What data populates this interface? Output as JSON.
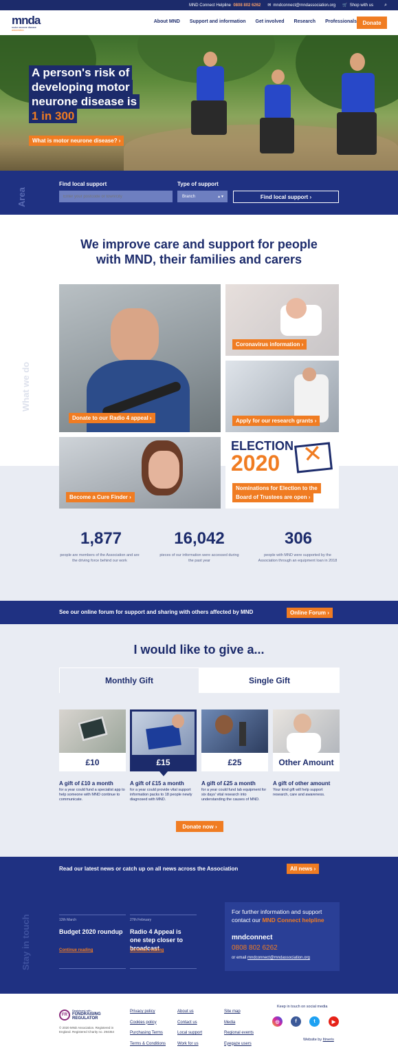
{
  "topbar": {
    "helpline_label": "MND Connect Helpline",
    "helpline_number": "0808 802 6262",
    "email": "mndconnect@mndassociation.org",
    "shop": "Shop with us"
  },
  "header": {
    "logo_main": "mnda",
    "logo_sub1": "motor neurone disease",
    "logo_sub2": "association",
    "nav": [
      "About MND",
      "Support and information",
      "Get involved",
      "Research",
      "Professionals"
    ],
    "donate": "Donate"
  },
  "hero": {
    "line1": "A person's risk of",
    "line2": "developing motor",
    "line3": "neurone disease is",
    "line4": "1 in 300",
    "link": "What is motor neurone disease? ›"
  },
  "find": {
    "vertical": "Area",
    "label_local": "Find local support",
    "label_type": "Type of support",
    "postcode_placeholder": "Enter your postcode or town/city",
    "branch_value": "Branch",
    "button": "Find local support ›"
  },
  "mission": {
    "line1": "We improve care and support for people",
    "line2": "with MND, their families and carers",
    "vertical": "What we do"
  },
  "tiles": {
    "radio": "Donate to our Radio 4 appeal ›",
    "corona": "Coronavirus information ›",
    "grants": "Apply for our research grants ›",
    "cure": "Become a Cure Finder ›",
    "election_word": "ELECTION",
    "election_year": "2020",
    "election_l1": "Nominations for Election to the",
    "election_l2": "Board of Trustees are open ›"
  },
  "stats": [
    {
      "num": "1,877",
      "text": "people are members of the Association and are the driving force behind our work"
    },
    {
      "num": "16,042",
      "text": "pieces of our information were accessed during the past year"
    },
    {
      "num": "306",
      "text": "people with MND were supported by the Association through an equipment loan in 2018"
    }
  ],
  "forum": {
    "text": "See our online forum for support and sharing with others affected by MND",
    "button": "Online Forum ›"
  },
  "give": {
    "title": "I would like to give a...",
    "tab_monthly": "Monthly Gift",
    "tab_single": "Single Gift",
    "cards": [
      {
        "amount": "£10",
        "heading": "A gift of £10 a month",
        "desc": "for a year could fund a specialist app to help someone with MND continue to communicate."
      },
      {
        "amount": "£15",
        "heading": "A gift of £15 a month",
        "desc": "for a year could provide vital support information packs to 18 people newly diagnosed with MND."
      },
      {
        "amount": "£25",
        "heading": "A gift of £25 a month",
        "desc": "for a year could fund lab equipment for six days' vital research into understanding the causes of MND."
      },
      {
        "amount": "Other Amount",
        "heading": "A gift of other amount",
        "desc": "Your kind gift will help support research, care and awareness."
      }
    ],
    "donate_now": "Donate now ›"
  },
  "news": {
    "intro": "Read our latest news or catch up on all news across the Association",
    "all_news": "All news ›",
    "vertical": "Stay in touch",
    "items": [
      {
        "date": "12th March",
        "title": "Budget 2020 roundup",
        "link": "Continue reading"
      },
      {
        "date": "27th February",
        "title": "Radio 4 Appeal is one step closer to broadcast",
        "link": "Continue reading"
      }
    ],
    "contact_text": "For further information and support contact our",
    "contact_bold": "MND Connect helpline",
    "contact_brand": "mndconnect",
    "contact_phone": "0808 802 6262",
    "contact_or": "or email",
    "contact_email": "mndconnect@mndassociation.org"
  },
  "footer": {
    "fr_badge": "FR",
    "fr_small": "Registered with",
    "fr_line1": "FUNDRAISING",
    "fr_line2": "REGULATOR",
    "copyright": "© 2020 MND Association. Registered in England. Registered Charity no. 294354",
    "col1": [
      "Privacy policy",
      "Cookies policy",
      "Purchasing Terms",
      "Terms & Conditions"
    ],
    "col2": [
      "About us",
      "Contact us",
      "Local support",
      "Work for us"
    ],
    "col3": [
      "Site map",
      "Media",
      "Regional events",
      "Eyegaze users"
    ],
    "social_title": "Keep in touch on social media",
    "website_by": "Website by",
    "agency": "Itineris"
  },
  "colors": {
    "navy": "#1c2b6b",
    "blue": "#1f3182",
    "orange": "#f07c22",
    "grey": "#e9ecf3"
  }
}
